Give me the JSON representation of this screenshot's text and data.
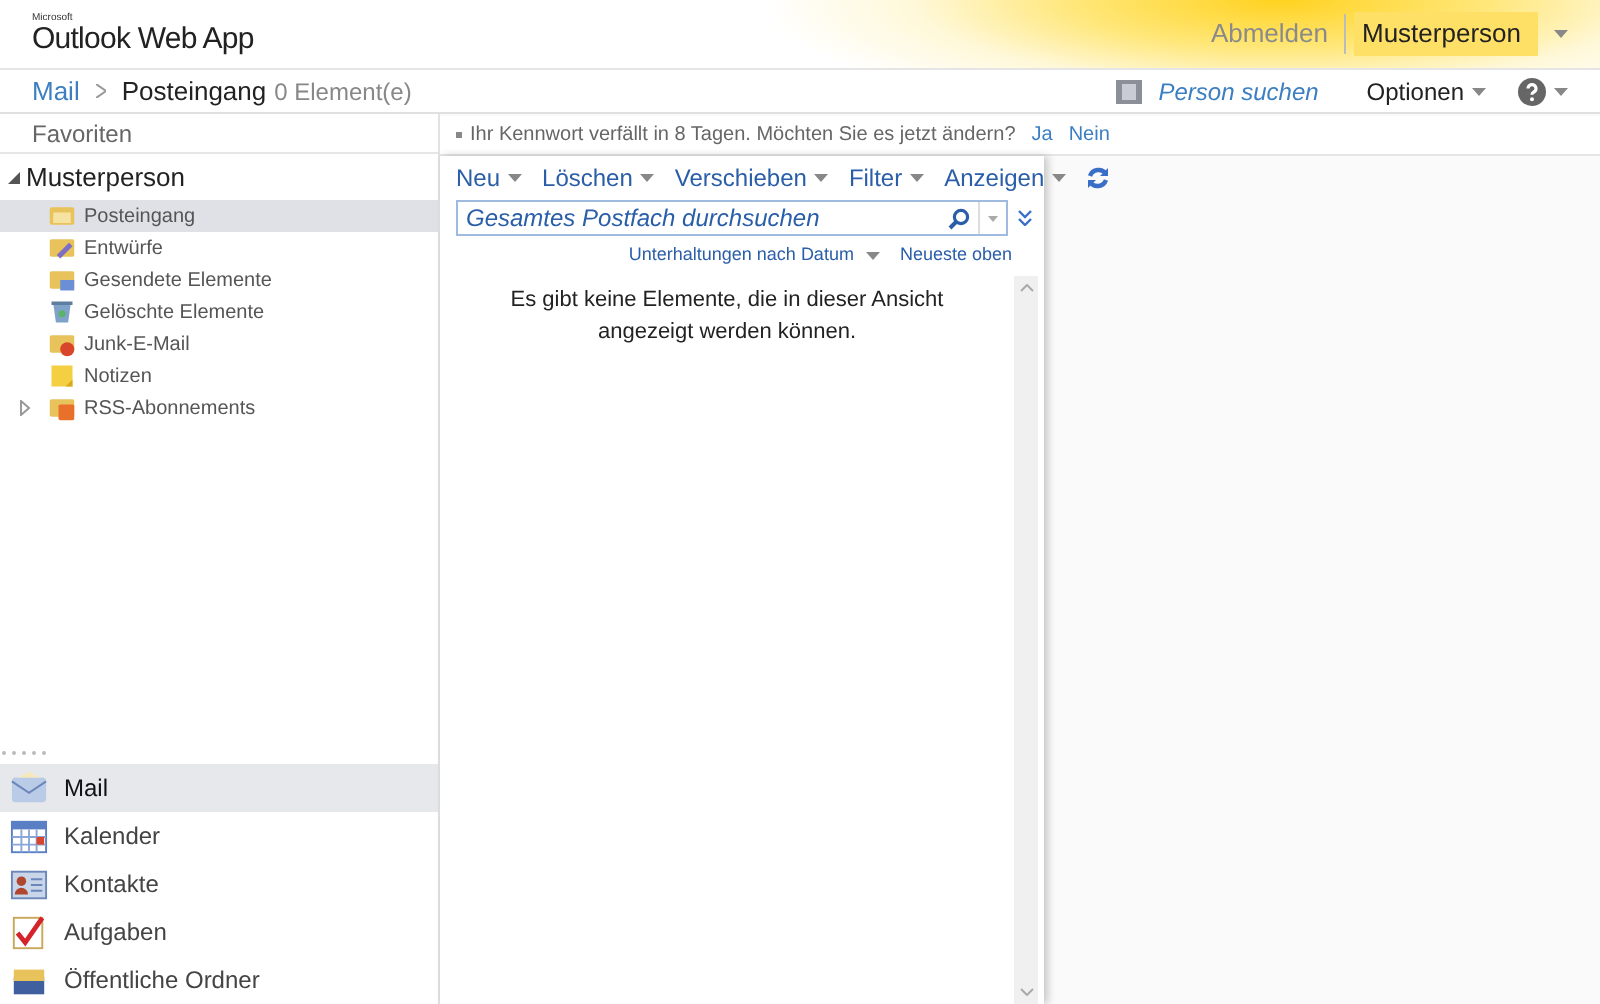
{
  "header": {
    "logo_small": "Microsoft",
    "logo": "Outlook Web App",
    "signout": "Abmelden",
    "user": "Musterperson"
  },
  "breadcrumb": {
    "root": "Mail",
    "folder": "Posteingang",
    "count": "0 Element(e)"
  },
  "toolbar_right": {
    "find_person": "Person suchen",
    "options": "Optionen"
  },
  "sidebar": {
    "favorites": "Favoriten",
    "tree": {
      "label": "Musterperson",
      "expanded": true,
      "children": [
        {
          "label": "Posteingang",
          "kind": "inbox",
          "selected": true,
          "expandable": false
        },
        {
          "label": "Entwürfe",
          "kind": "drafts",
          "selected": false,
          "expandable": false
        },
        {
          "label": "Gesendete Elemente",
          "kind": "sent",
          "selected": false,
          "expandable": false
        },
        {
          "label": "Gelöschte Elemente",
          "kind": "deleted",
          "selected": false,
          "expandable": false
        },
        {
          "label": "Junk-E-Mail",
          "kind": "junk",
          "selected": false,
          "expandable": false
        },
        {
          "label": "Notizen",
          "kind": "notes",
          "selected": false,
          "expandable": false
        },
        {
          "label": "RSS-Abonnements",
          "kind": "rss",
          "selected": false,
          "expandable": true
        }
      ]
    },
    "nav": [
      {
        "label": "Mail",
        "kind": "mail",
        "selected": true
      },
      {
        "label": "Kalender",
        "kind": "calendar",
        "selected": false
      },
      {
        "label": "Kontakte",
        "kind": "contacts",
        "selected": false
      },
      {
        "label": "Aufgaben",
        "kind": "tasks",
        "selected": false
      },
      {
        "label": "Öffentliche Ordner",
        "kind": "public",
        "selected": false
      }
    ]
  },
  "notice": {
    "text": "Ihr Kennwort verfällt in 8 Tagen. Möchten Sie es jetzt ändern?",
    "yes": "Ja",
    "no": "Nein"
  },
  "list": {
    "menu": [
      "Neu",
      "Löschen",
      "Verschieben",
      "Filter",
      "Anzeigen"
    ],
    "search": {
      "placeholder": "Gesamtes Postfach durchsuchen"
    },
    "sort": "Unterhaltungen nach Datum",
    "order": "Neueste oben",
    "empty": "Es gibt keine Elemente, die in dieser Ansicht angezeigt werden können."
  }
}
